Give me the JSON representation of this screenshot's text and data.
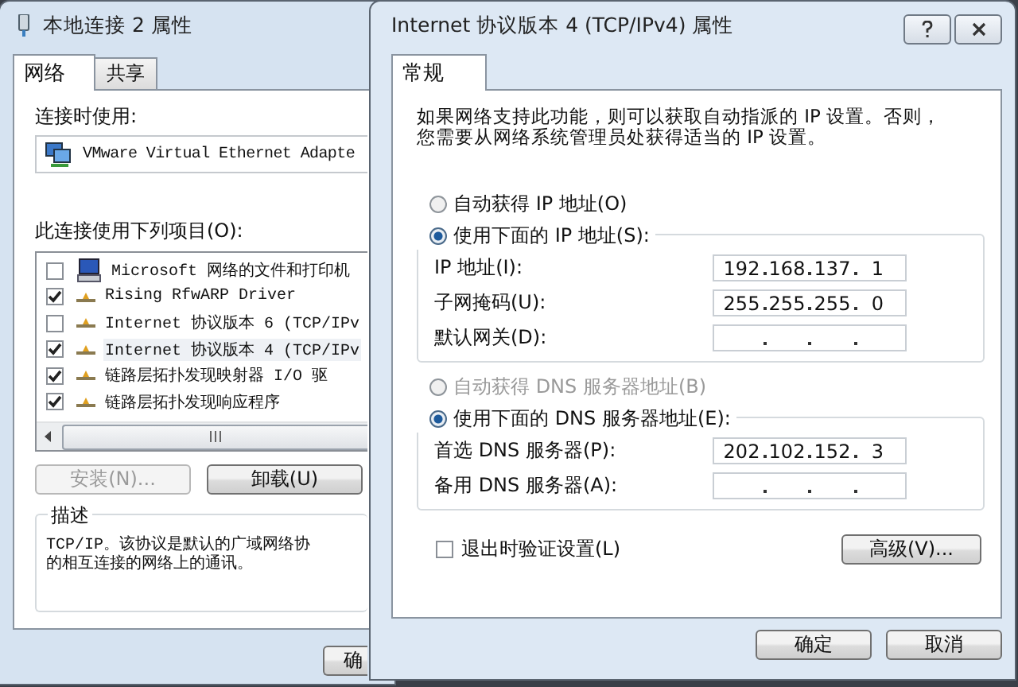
{
  "background_dialog": {
    "title": "本地连接 2 属性",
    "tabs": [
      {
        "label": "网络",
        "selected": true
      },
      {
        "label": "共享",
        "selected": false
      }
    ],
    "connect_label": "连接时使用:",
    "adapter": "VMware Virtual Ethernet Adapte",
    "items_label": "此连接使用下列项目(O):",
    "items": [
      {
        "kind": "computer",
        "label": "Microsoft 网络的文件和打印机",
        "checked": false,
        "selected": false
      },
      {
        "kind": "protocol",
        "label": "Rising RfwARP Driver",
        "checked": true,
        "selected": false
      },
      {
        "kind": "protocol",
        "label": "Internet 协议版本 6 (TCP/IPv",
        "checked": false,
        "selected": false
      },
      {
        "kind": "protocol",
        "label": "Internet 协议版本 4 (TCP/IPv",
        "checked": true,
        "selected": true
      },
      {
        "kind": "protocol",
        "label": "链路层拓扑发现映射器 I/O 驱",
        "checked": true,
        "selected": false
      },
      {
        "kind": "protocol",
        "label": "链路层拓扑发现响应程序",
        "checked": true,
        "selected": false
      }
    ],
    "buttons": [
      {
        "label": "安装(N)...",
        "disabled": true
      },
      {
        "label": "卸载(U)",
        "disabled": false
      }
    ],
    "description_label": "描述",
    "description_lines": [
      "TCP/IP。该协议是默认的广域网络协",
      "的相互连接的网络上的通讯。"
    ],
    "bottom_button": "确"
  },
  "dialog": {
    "title": "Internet 协议版本 4 (TCP/IPv4) 属性",
    "tabs": [
      {
        "label": "常规",
        "selected": true
      }
    ],
    "intro_lines": [
      "如果网络支持此功能，则可以获取自动指派的 IP 设置。否则，",
      "您需要从网络系统管理员处获得适当的 IP 设置。"
    ],
    "ip_options": [
      {
        "label": "自动获得 IP 地址(O)",
        "selected": false,
        "disabled": false
      },
      {
        "label": "使用下面的 IP 地址(S):",
        "selected": true,
        "disabled": false
      }
    ],
    "ip_fields": [
      {
        "label": "IP 地址(I):",
        "octets": [
          "192",
          "168",
          "137",
          "1"
        ]
      },
      {
        "label": "子网掩码(U):",
        "octets": [
          "255",
          "255",
          "255",
          "0"
        ]
      },
      {
        "label": "默认网关(D):"
      }
    ],
    "dns_options": [
      {
        "label": "自动获得 DNS 服务器地址(B)",
        "selected": false,
        "disabled": true
      },
      {
        "label": "使用下面的 DNS 服务器地址(E):",
        "selected": true,
        "disabled": false
      }
    ],
    "dns_fields": [
      {
        "label": "首选 DNS 服务器(P):",
        "octets": [
          "202",
          "102",
          "152",
          "3"
        ]
      },
      {
        "label": "备用 DNS 服务器(A):"
      }
    ],
    "validate": {
      "label": "退出时验证设置(L)",
      "checked": false
    },
    "advanced_button": "高级(V)...",
    "buttons": [
      "确定",
      "取消"
    ]
  }
}
